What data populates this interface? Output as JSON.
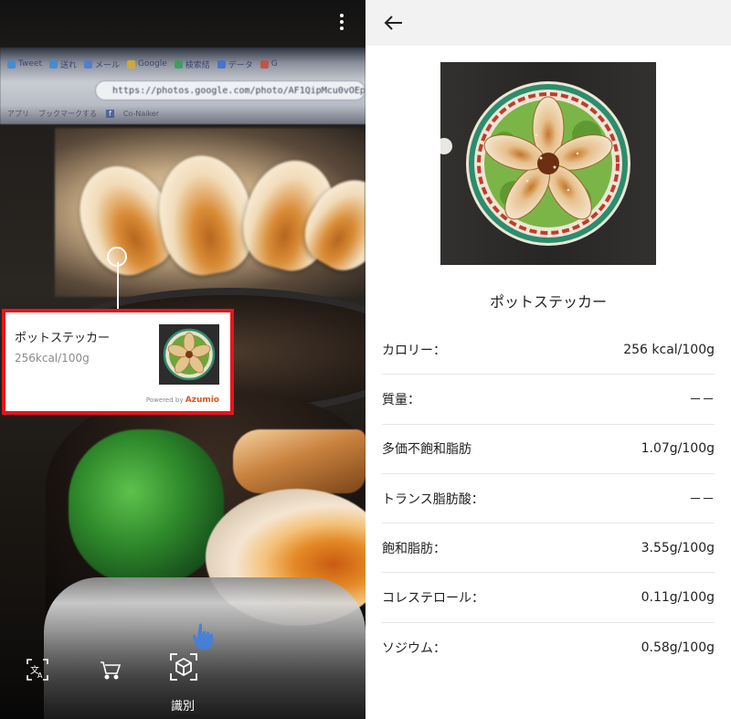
{
  "camera_view": {
    "browser_tabs": [
      "Tweet",
      "送れ",
      "メール",
      "Google",
      "検索結",
      "データ",
      "G"
    ],
    "url": "https://photos.google.com/photo/AF1QipMcu0vOEptCjC",
    "bookmarks": [
      "アプリ",
      "ブックマークする",
      "f",
      "Co-Naiker"
    ],
    "result_card": {
      "title": "ポットステッカー",
      "kcal": "256kcal/100g",
      "powered_by": "Powered by",
      "brand": "Azumio"
    },
    "toolbar": {
      "identify_label": "識別"
    }
  },
  "detail": {
    "food_name": "ポットステッカー",
    "nutrients": [
      {
        "label": "カロリー：",
        "value": "256 kcal/100g"
      },
      {
        "label": "質量：",
        "value": "－－"
      },
      {
        "label": "多価不飽和脂肪",
        "value": "1.07g/100g"
      },
      {
        "label": "トランス脂肪酸：",
        "value": "－－"
      },
      {
        "label": "飽和脂肪：",
        "value": "3.55g/100g"
      },
      {
        "label": "コレステロール：",
        "value": "0.11g/100g"
      },
      {
        "label": "ソジウム：",
        "value": "0.58g/100g"
      }
    ]
  },
  "colors": {
    "highlight_border": "#e8141b",
    "azumio_brand": "#e0531a",
    "appbar_bg": "#f2f2f2"
  },
  "icons": [
    "more-vert-icon",
    "translate-icon",
    "shopping-cart-icon",
    "lens-identify-icon",
    "hand-pointer-icon",
    "back-arrow-icon"
  ]
}
